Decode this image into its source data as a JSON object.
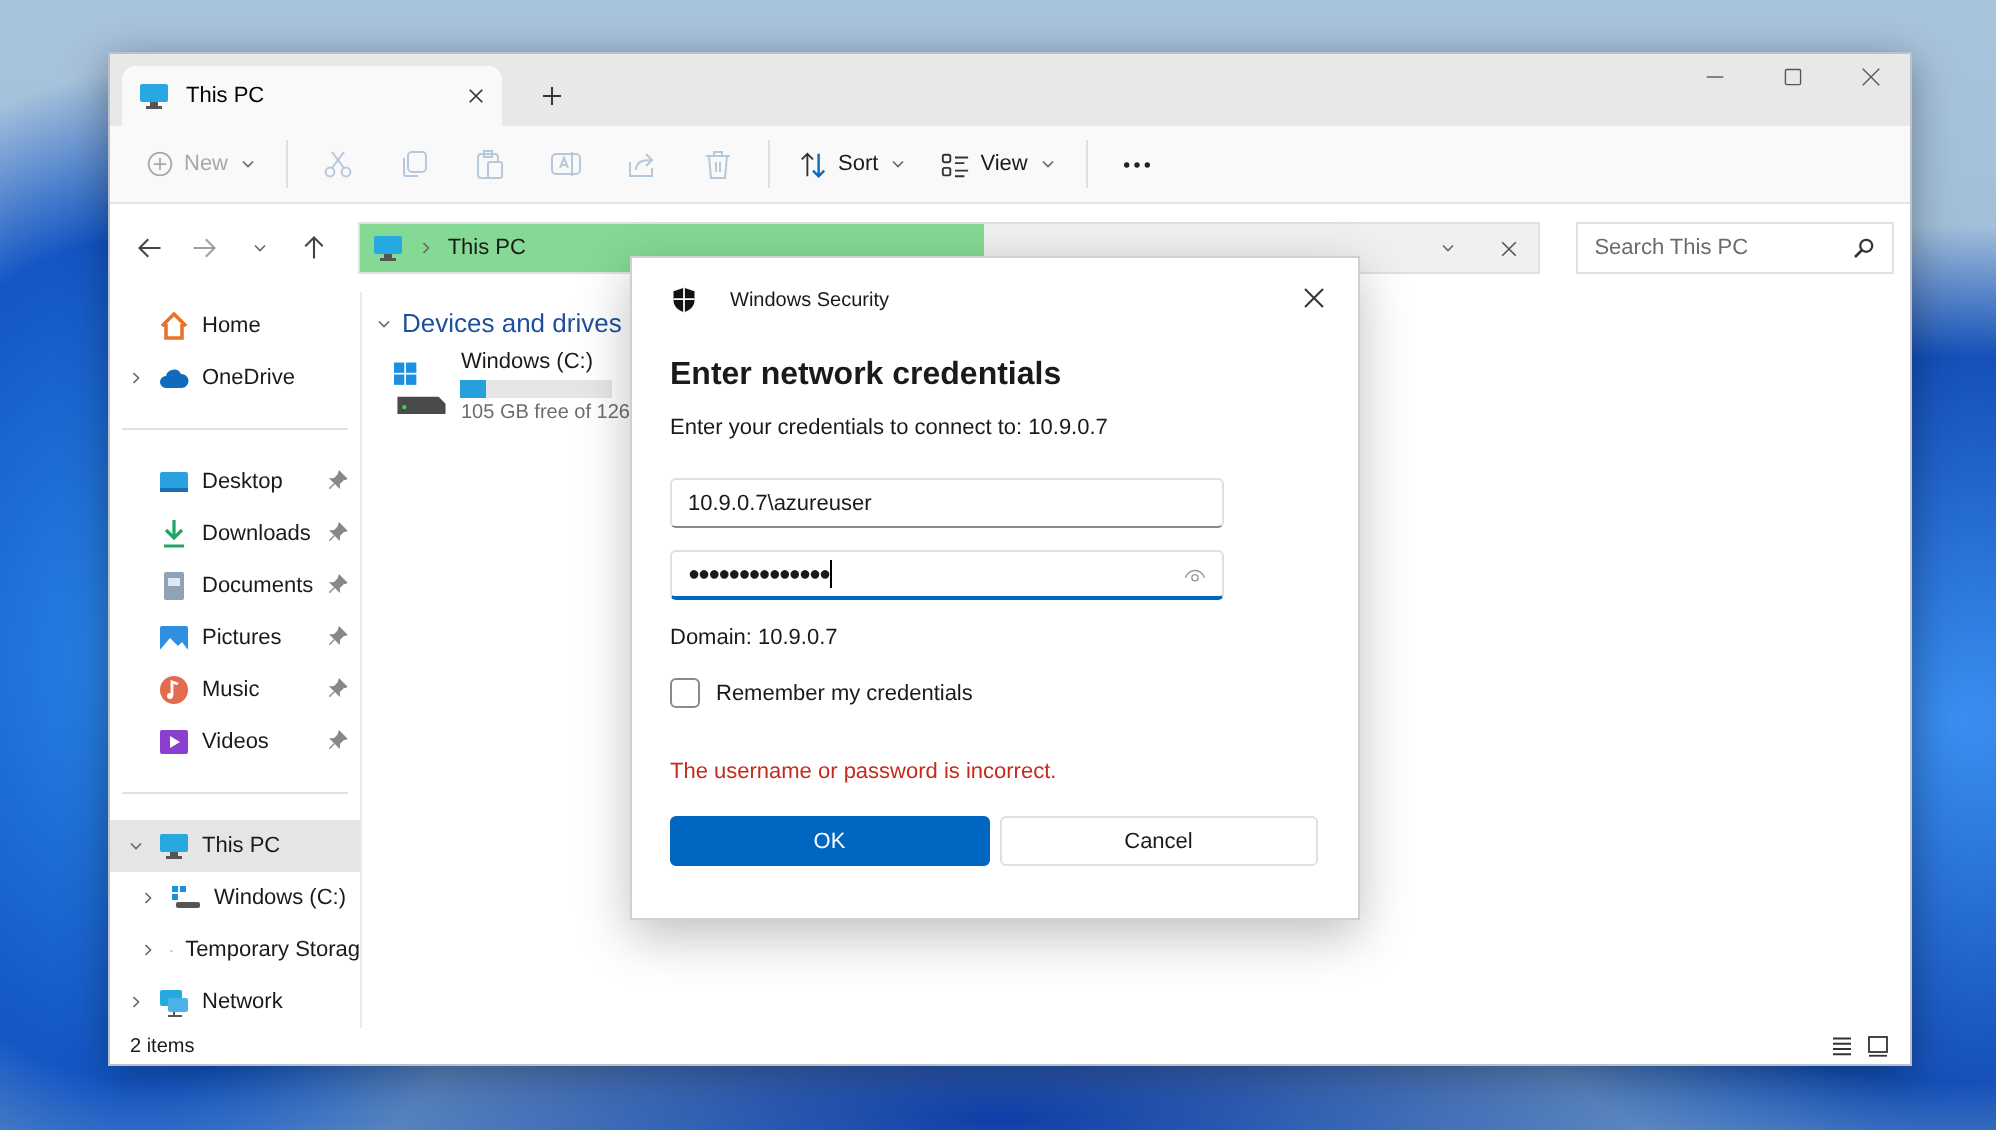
{
  "window": {
    "tabs": [
      {
        "label": "This PC",
        "selected": true
      }
    ]
  },
  "toolbar": {
    "new": {
      "label": "New",
      "disabled": true
    },
    "actions": [
      {
        "kind": "cut",
        "disabled": true
      },
      {
        "kind": "copy",
        "disabled": true
      },
      {
        "kind": "paste",
        "disabled": true
      },
      {
        "kind": "rename",
        "disabled": true
      },
      {
        "kind": "share",
        "disabled": true
      },
      {
        "kind": "delete",
        "disabled": true
      }
    ],
    "sort": {
      "label": "Sort"
    },
    "view": {
      "label": "View"
    }
  },
  "navigation": {
    "forward_disabled": true
  },
  "address_bar": {
    "path": "This PC",
    "level": 0.53
  },
  "search": {
    "placeholder": "Search This PC"
  },
  "sidebar": {
    "items": [
      {
        "kind": "home",
        "label": "Home",
        "expandable": false
      },
      {
        "kind": "cloud",
        "label": "OneDrive",
        "expandable": true
      }
    ],
    "quick_access": [
      {
        "kind": "desktop",
        "label": "Desktop",
        "pinned": true
      },
      {
        "kind": "downloads",
        "label": "Downloads",
        "pinned": true
      },
      {
        "kind": "documents",
        "label": "Documents",
        "pinned": true
      },
      {
        "kind": "pictures",
        "label": "Pictures",
        "pinned": true
      },
      {
        "kind": "music",
        "label": "Music",
        "pinned": true
      },
      {
        "kind": "videos",
        "label": "Videos",
        "pinned": true
      }
    ],
    "tree": [
      {
        "kind": "pc",
        "label": "This PC",
        "expanded": true,
        "selected": true,
        "children": [
          {
            "kind": "windows-drive",
            "label": "Windows (C:)",
            "expanded": false,
            "selected": false
          },
          {
            "kind": "drive",
            "label": "Temporary Storag",
            "expanded": false,
            "selected": false
          }
        ]
      },
      {
        "kind": "network",
        "label": "Network",
        "expanded": false,
        "selected": false
      }
    ]
  },
  "content": {
    "group": {
      "title": "Devices and drives",
      "expanded": true
    },
    "drives": [
      {
        "name": "Windows (C:)",
        "level": 0.17,
        "free_text": "105 GB free of 126"
      }
    ]
  },
  "status_bar": {
    "count": "2 items"
  },
  "dialog": {
    "app_name": "Windows Security",
    "title": "Enter network credentials",
    "message": "Enter your credentials to connect to: 10.9.0.7",
    "username": {
      "value": "10.9.0.7\\azureuser"
    },
    "password": {
      "value": "●●●●●●●●●●●●●●",
      "focused": true
    },
    "domain": "Domain: 10.9.0.7",
    "remember": {
      "label": "Remember my credentials",
      "checked": false
    },
    "error": "The username or password is incorrect.",
    "buttons": [
      {
        "label": "OK",
        "kind": "primary"
      },
      {
        "label": "Cancel",
        "kind": "secondary"
      }
    ]
  }
}
